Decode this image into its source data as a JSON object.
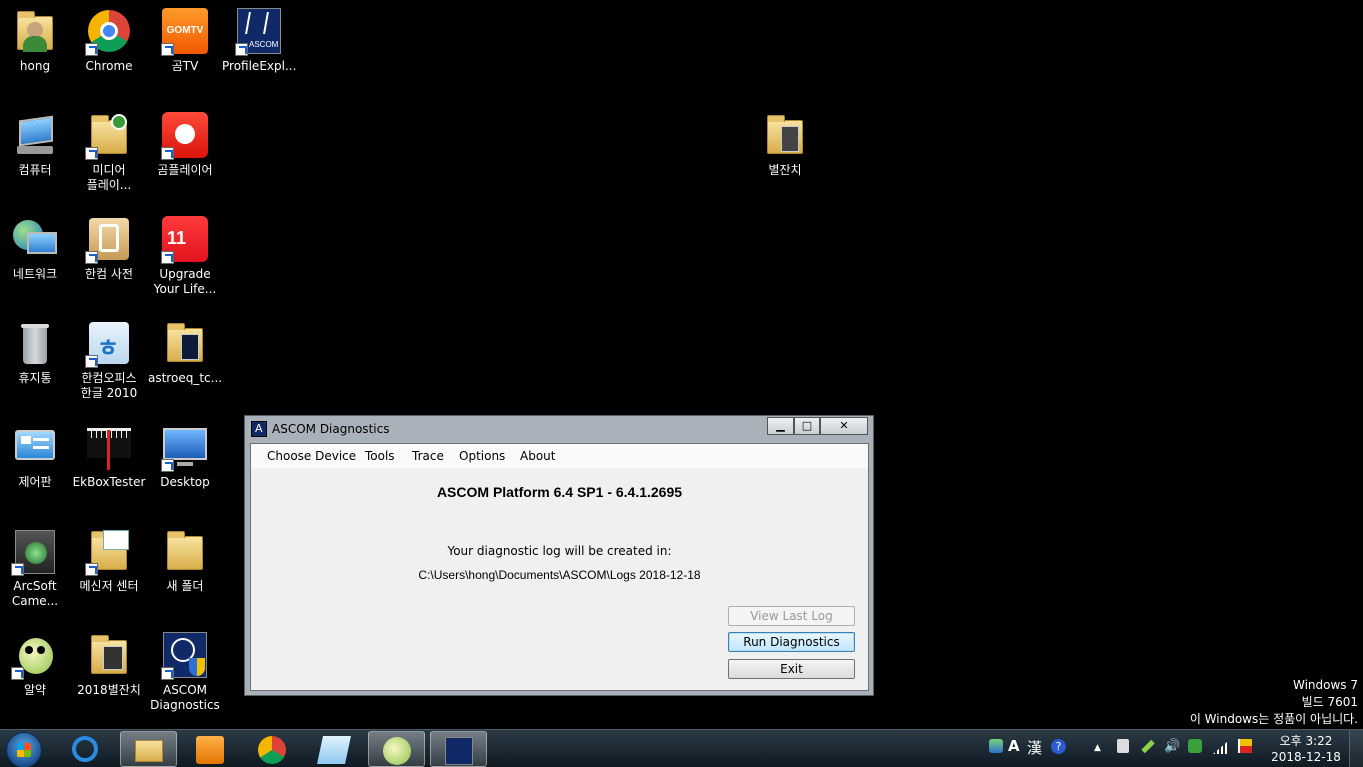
{
  "desktop": {
    "icons": [
      {
        "label": "hong"
      },
      {
        "label": "Chrome"
      },
      {
        "label": "곰TV"
      },
      {
        "label": "ProfileExpl..."
      },
      {
        "label": "컴퓨터"
      },
      {
        "label": "미디어\n플레이..."
      },
      {
        "label": "곰플레이어"
      },
      {
        "label": "별잔치"
      },
      {
        "label": "네트워크"
      },
      {
        "label": "한컴 사전"
      },
      {
        "label": "Upgrade\nYour Life..."
      },
      {
        "label": "휴지통"
      },
      {
        "label": "한컴오피스\n한글 2010"
      },
      {
        "label": "astroeq_tc..."
      },
      {
        "label": "제어판"
      },
      {
        "label": "EkBoxTester"
      },
      {
        "label": "Desktop"
      },
      {
        "label": "ArcSoft\nCame..."
      },
      {
        "label": "메신저 센터"
      },
      {
        "label": "새 폴더"
      },
      {
        "label": "알약"
      },
      {
        "label": "2018별잔치"
      },
      {
        "label": "ASCOM\nDiagnostics"
      }
    ],
    "icon_badges": {
      "gomtv": "GOMTV",
      "profile": "ASCOM",
      "eleven": "11"
    },
    "watermark": {
      "line1": "Windows 7",
      "line2": "빌드 7601",
      "line3": "이 Windows는 정품이 아닙니다."
    }
  },
  "window": {
    "title": "ASCOM Diagnostics",
    "controls": {
      "minimize": "▁",
      "maximize": "□",
      "close": "✕"
    },
    "menu": [
      "Choose Device",
      "Tools",
      "Trace",
      "Options",
      "About"
    ],
    "platform": "ASCOM Platform 6.4 SP1 - 6.4.1.2695",
    "log_label": "Your diagnostic log will be created in:",
    "log_path": "C:\\Users\\hong\\Documents\\ASCOM\\Logs 2018-12-18",
    "buttons": {
      "view_log": "View Last Log",
      "run": "Run Diagnostics",
      "exit": "Exit"
    }
  },
  "taskbar": {
    "tray_text": {
      "lang": "A",
      "hanja": "漢",
      "help": "?"
    },
    "clock": {
      "time": "오후 3:22",
      "date": "2018-12-18"
    }
  },
  "colors": {
    "desktop": "#000000",
    "titlebar": "#a9b1ba",
    "client": "#f0f0f0"
  }
}
